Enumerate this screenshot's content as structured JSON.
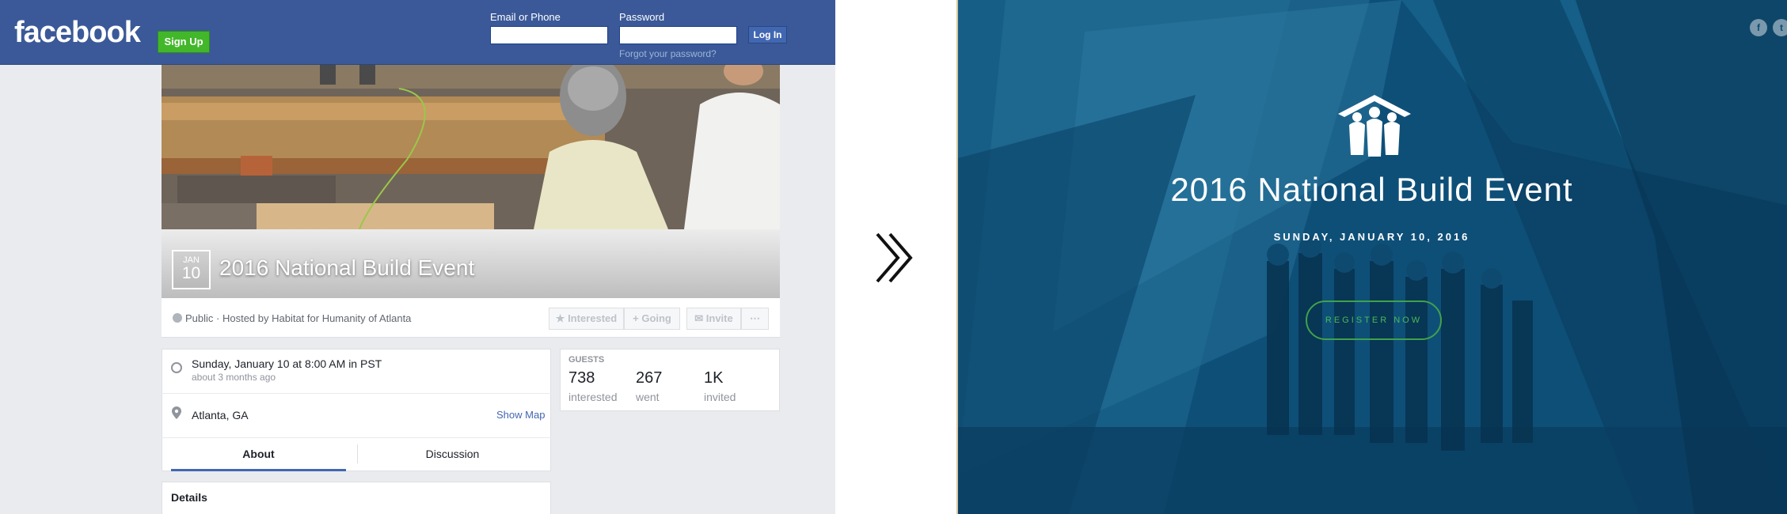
{
  "facebook": {
    "logo_text": "facebook",
    "signup_label": "Sign Up",
    "email_label": "Email or Phone",
    "email_value": "",
    "password_label": "Password",
    "password_value": "",
    "login_label": "Log In",
    "forgot_label": "Forgot your password?",
    "event": {
      "month": "JAN",
      "day": "10",
      "title": "2016 National Build Event",
      "meta": "Public · Hosted by Habitat for Humanity of Atlanta",
      "actions": {
        "interested": "Interested",
        "going": "Going",
        "invite": "Invite",
        "more": "⋯"
      },
      "when_main": "Sunday, January 10 at 8:00 AM in PST",
      "when_sub": "about 3 months ago",
      "where": "Atlanta, GA",
      "show_map": "Show Map",
      "tabs": {
        "about": "About",
        "discussion": "Discussion"
      },
      "details_heading": "Details"
    },
    "guests": {
      "heading": "GUESTS",
      "interested": {
        "count": "738",
        "label": "interested"
      },
      "went": {
        "count": "267",
        "label": "went"
      },
      "invited": {
        "count": "1K",
        "label": "invited"
      }
    }
  },
  "arrow_icon": "double-chevron-right-icon",
  "hero": {
    "title": "2016 National Build Event",
    "date": "SUNDAY, JANUARY 10, 2016",
    "register_label": "REGISTER NOW",
    "social": {
      "facebook_glyph": "f",
      "twitter_glyph": "t"
    },
    "accent_color": "#3fa24a",
    "overlay_color": "#0c4a70"
  }
}
